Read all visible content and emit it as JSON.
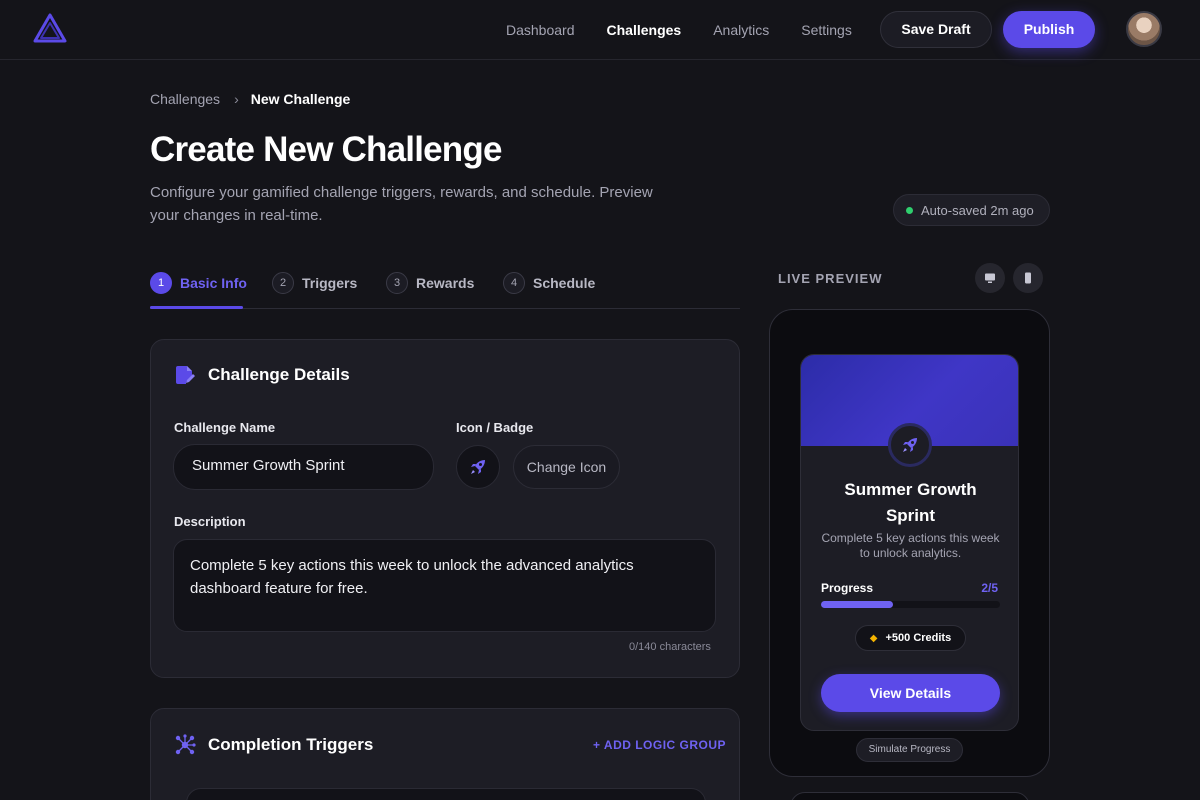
{
  "nav": {
    "items": [
      {
        "label": "Dashboard",
        "active": false
      },
      {
        "label": "Challenges",
        "active": true
      },
      {
        "label": "Analytics",
        "active": false
      },
      {
        "label": "Settings",
        "active": false
      }
    ],
    "save_draft": "Save Draft",
    "publish": "Publish"
  },
  "breadcrumb": {
    "parent": "Challenges",
    "separator": "›",
    "current": "New Challenge"
  },
  "header": {
    "title": "Create New Challenge",
    "subtitle": "Configure your gamified challenge triggers, rewards, and schedule. Preview your changes in real-time.",
    "autosave": "Auto-saved 2m ago"
  },
  "tabs": [
    {
      "num": "1",
      "label": "Basic Info",
      "active": true
    },
    {
      "num": "2",
      "label": "Triggers",
      "active": false
    },
    {
      "num": "3",
      "label": "Rewards",
      "active": false
    },
    {
      "num": "4",
      "label": "Schedule",
      "active": false
    }
  ],
  "details": {
    "title": "Challenge Details",
    "icon": "edit-document-icon",
    "name_label": "Challenge Name",
    "name_value": "Summer Growth Sprint",
    "icon_label": "Icon / Badge",
    "badge_icon": "rocket-icon",
    "change_icon": "Change Icon",
    "desc_label": "Description",
    "desc_value": "Complete 5 key actions this week to unlock the advanced analytics dashboard feature for free.",
    "char_count": "0/140 characters"
  },
  "triggers": {
    "title": "Completion Triggers",
    "icon": "network-nodes-icon",
    "add_logic": "+ ADD LOGIC GROUP"
  },
  "preview": {
    "label": "LIVE PREVIEW",
    "desktop_icon": "monitor-icon",
    "mobile_icon": "phone-icon",
    "card_title": "Summer Growth Sprint",
    "card_desc": "Complete 5 key actions this week to unlock analytics.",
    "progress_label": "Progress",
    "progress_value": "2/5",
    "progress_fraction": 0.4,
    "credits": "+500 Credits",
    "credits_icon": "gem-icon",
    "view_details": "View Details",
    "simulate": "Simulate Progress"
  },
  "colors": {
    "accent": "#5b4ae8",
    "background": "#141419",
    "card": "#1d1d25",
    "autosave_dot": "#2fcf6e",
    "gem": "#f5b400"
  }
}
